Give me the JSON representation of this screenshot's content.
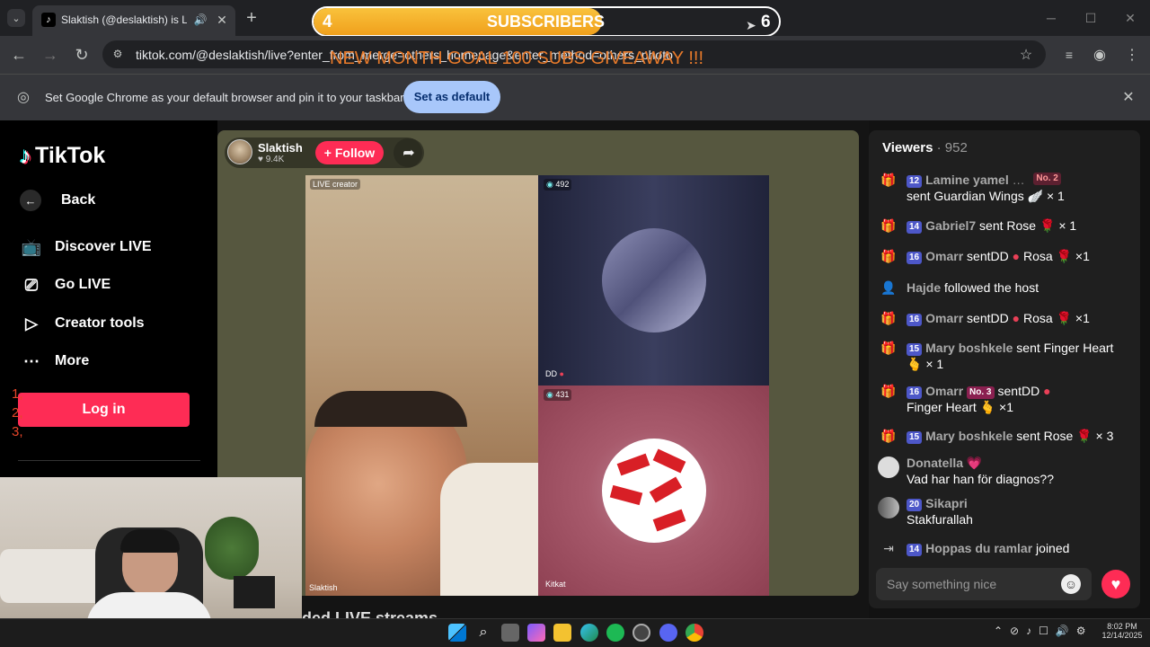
{
  "overlay": {
    "goal_current": "4",
    "goal_label": "SUBSCRIBERS",
    "goal_target": "6",
    "goal_progress": 0.62,
    "goal_banner": "NEW MONTH GOAL 100 SUBS GIVEAWAY !!!",
    "ranking": [
      "1,",
      "2,",
      "3,"
    ]
  },
  "browser": {
    "tab_title": "Slaktish (@deslaktish) is LIVE",
    "url": "tiktok.com/@deslaktish/live?enter_from_merge=others_homepage&enter_method=others_photo",
    "infobar_text": "Set Google Chrome as your default browser and pin it to your taskbar",
    "set_default_label": "Set as default"
  },
  "sidebar": {
    "logo": "TikTok",
    "back_label": "Back",
    "items": [
      {
        "label": "Discover LIVE",
        "icon": "tv-icon"
      },
      {
        "label": "Go LIVE",
        "icon": "camera-icon"
      },
      {
        "label": "Creator tools",
        "icon": "play-icon"
      },
      {
        "label": "More",
        "icon": "more-icon"
      }
    ],
    "login_label": "Log in"
  },
  "stream": {
    "host_name": "Slaktish",
    "host_likes": "9.4K",
    "follow_label": "+ Follow",
    "host_tag": "LIVE creator",
    "host_bottom": "Slaktish",
    "guest1_count": "492",
    "guest1_name": "DD",
    "guest2_count": "431",
    "guest2_name": "Kitkat",
    "below_title": "ded LIVE streams"
  },
  "chat": {
    "viewers_label": "Viewers",
    "viewers_count": "952",
    "placeholder": "Say something nice",
    "messages": [
      {
        "level": "12",
        "user": "Lamine yamel",
        "rank": "No. 2",
        "text": "sent Guardian Wings",
        "suffix": "× 1",
        "icon": "gift-icon"
      },
      {
        "level": "14",
        "user": "Gabriel7",
        "text": "sent Rose",
        "suffix": "× 1",
        "icon": "gift-icon"
      },
      {
        "level": "16",
        "user": "Omarr",
        "text": "sentDD",
        "extra": "Rosa",
        "suffix": "×1",
        "icon": "gift-icon"
      },
      {
        "user": "Hajde",
        "text": "followed the host",
        "icon": "user-icon"
      },
      {
        "level": "16",
        "user": "Omarr",
        "text": "sentDD",
        "extra": "Rosa",
        "suffix": "×1",
        "icon": "gift-icon"
      },
      {
        "level": "15",
        "user": "Mary boshkele",
        "text": "sent Finger Heart",
        "suffix": "× 1",
        "icon": "gift-icon"
      },
      {
        "level": "16",
        "user": "Omarr",
        "rank": "No. 3",
        "text": "sentDD",
        "extra": "Finger Heart",
        "suffix": "×1",
        "icon": "gift-icon"
      },
      {
        "level": "15",
        "user": "Mary boshkele",
        "text": "sent Rose",
        "suffix": "× 3",
        "icon": "gift-icon"
      },
      {
        "user": "Donatella",
        "text": "Vad har han för diagnos??",
        "icon": "avatar"
      },
      {
        "level": "20",
        "user": "Sikapri",
        "text": "Stakfurallah",
        "icon": "avatar"
      },
      {
        "level": "14",
        "user": "Hoppas du ramlar",
        "text": "joined",
        "icon": "join-icon"
      }
    ]
  },
  "taskbar": {
    "time": "8:02 PM",
    "date": "12/14/2025"
  }
}
